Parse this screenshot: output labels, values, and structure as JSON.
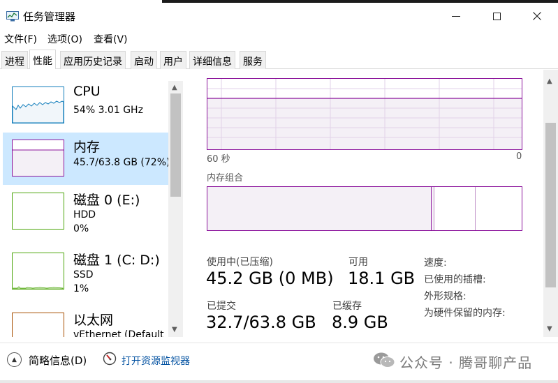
{
  "window": {
    "title": "任务管理器"
  },
  "menu": [
    "文件(F)",
    "选项(O)",
    "查看(V)"
  ],
  "tabs": [
    "进程",
    "性能",
    "应用历史记录",
    "启动",
    "用户",
    "详细信息",
    "服务"
  ],
  "active_tab": 1,
  "resources": [
    {
      "title": "CPU",
      "line1": "54%  3.01 GHz",
      "line2": "",
      "color": "#117dbb",
      "selected": false
    },
    {
      "title": "内存",
      "line1": "45.7/63.8 GB (72%)",
      "line2": "",
      "color": "#8b129b",
      "selected": true
    },
    {
      "title": "磁盘 0 (E:)",
      "line1": "HDD",
      "line2": "0%",
      "color": "#4da60c",
      "selected": false
    },
    {
      "title": "磁盘 1 (C: D:)",
      "line1": "SSD",
      "line2": "1%",
      "color": "#4da60c",
      "selected": false
    },
    {
      "title": "以太网",
      "line1": "vEthernet (Default",
      "line2": "",
      "color": "#a74f01",
      "selected": false
    }
  ],
  "memory": {
    "graph_usage_fraction": 0.72,
    "axis_left": "60 秒",
    "axis_right": "0",
    "composition_label": "内存组合",
    "composition": {
      "in_use_fraction": 0.71,
      "modified_fraction": 0.006,
      "standby_fraction": 0.14
    },
    "in_use_label": "使用中(已压缩)",
    "in_use_value": "45.2 GB (0 MB)",
    "available_label": "可用",
    "available_value": "18.1 GB",
    "committed_label": "已提交",
    "committed_value": "32.7/63.8 GB",
    "cached_label": "已缓存",
    "cached_value": "8.9 GB",
    "speed_label": "速度:",
    "slots_label": "已使用的插槽:",
    "form_label": "外形规格:",
    "reserved_label": "为硬件保留的内存:"
  },
  "footer": {
    "fewer_details": "简略信息(D)",
    "resource_monitor": "打开资源监视器"
  },
  "watermark": {
    "text": "公众号 · 腾哥聊产品"
  }
}
